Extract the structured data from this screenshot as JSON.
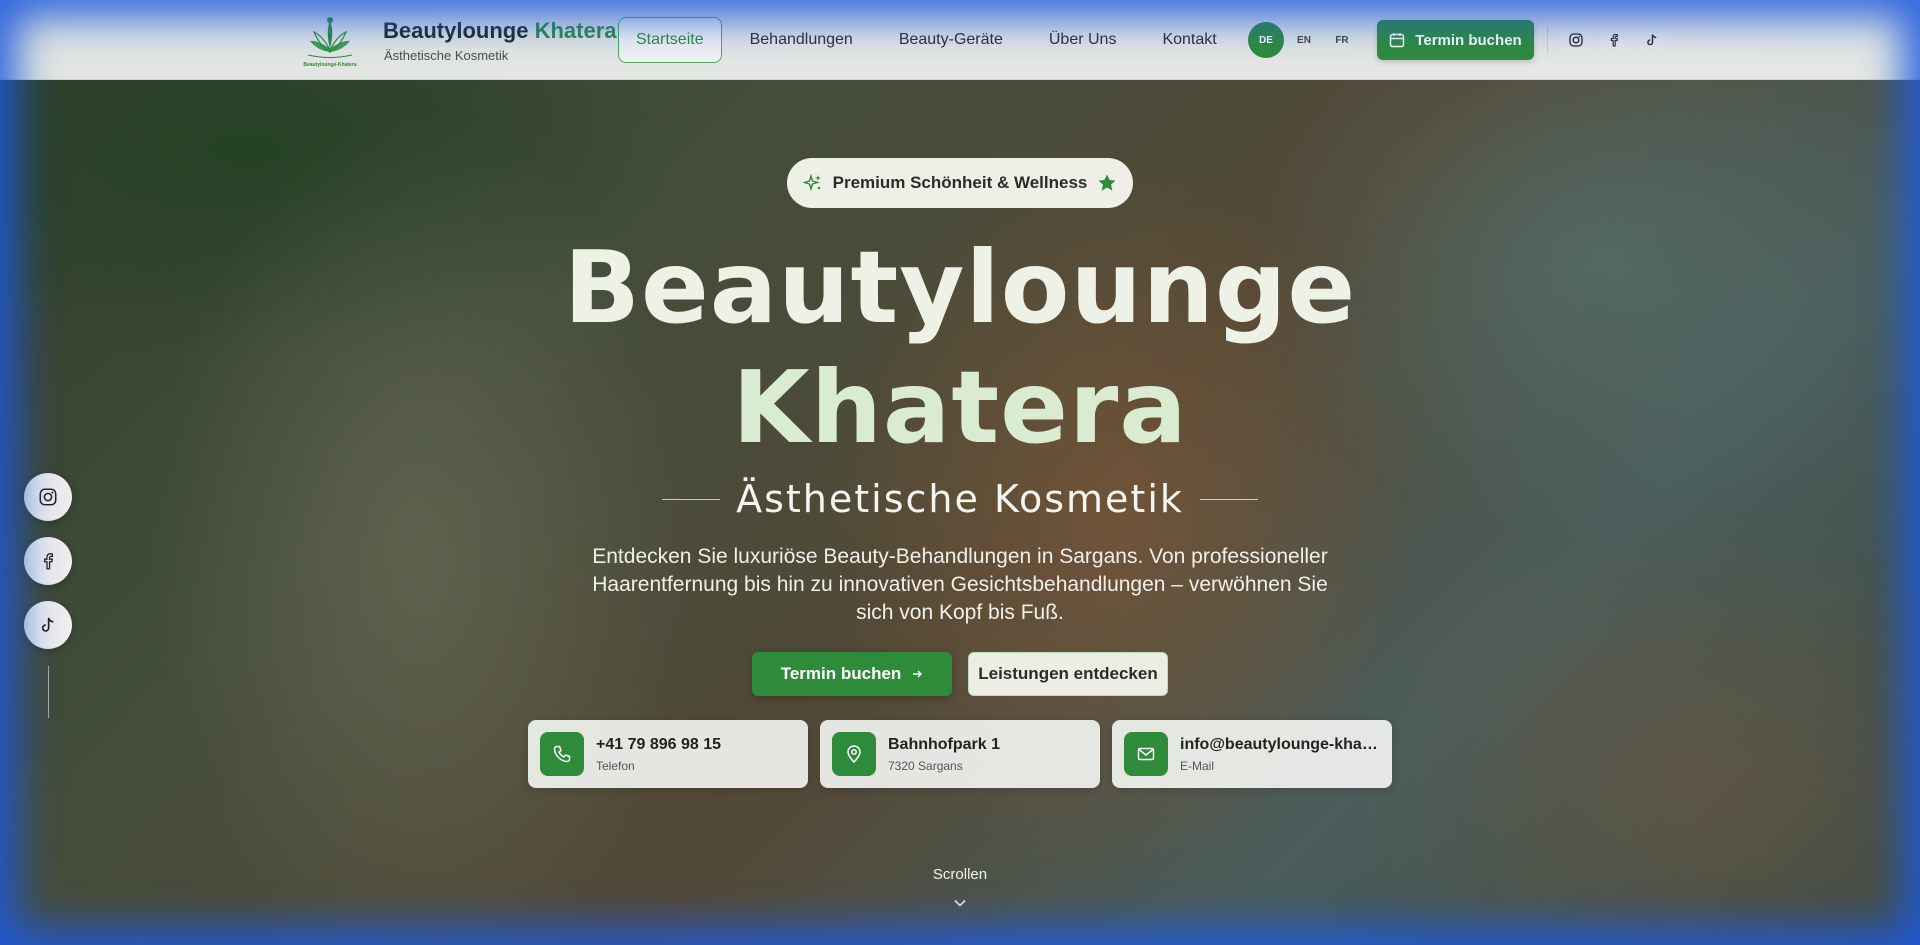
{
  "brand": {
    "name_main": "Beautylounge",
    "name_accent": "Khatera",
    "subtitle": "Ästhetische Kosmetik",
    "logo_text": "Beautylounge-Khatera"
  },
  "nav": {
    "items": [
      {
        "label": "Startseite",
        "active": true
      },
      {
        "label": "Behandlungen",
        "active": false
      },
      {
        "label": "Beauty-Geräte",
        "active": false
      },
      {
        "label": "Über Uns",
        "active": false
      },
      {
        "label": "Kontakt",
        "active": false
      }
    ]
  },
  "lang": {
    "options": [
      "DE",
      "EN",
      "FR"
    ],
    "selected": "DE"
  },
  "header": {
    "book_label": "Termin buchen"
  },
  "hero": {
    "badge": "Premium Schönheit & Wellness",
    "title_line1": "Beautylounge",
    "title_line2": "Khatera",
    "subtitle": "Ästhetische Kosmetik",
    "description": "Entdecken Sie luxuriöse Beauty-Behandlungen in Sargans. Von professioneller Haarentfernung bis hin zu innovativen Gesichtsbehandlungen – verwöhnen Sie sich von Kopf bis Fuß.",
    "cta_primary": "Termin buchen",
    "cta_secondary": "Leistungen entdecken",
    "scroll": "Scrollen"
  },
  "contact": {
    "phone": {
      "value": "+41 79 896 98 15",
      "label": "Telefon",
      "icon": "phone-icon"
    },
    "address": {
      "value": "Bahnhofpark 1",
      "label": "7320 Sargans",
      "icon": "map-pin-icon"
    },
    "email": {
      "value": "info@beautylounge-khatera.ch",
      "label": "E-Mail",
      "icon": "mail-icon"
    }
  },
  "colors": {
    "accent": "#2e8b3a",
    "header_bg": "#f0f2f0"
  }
}
